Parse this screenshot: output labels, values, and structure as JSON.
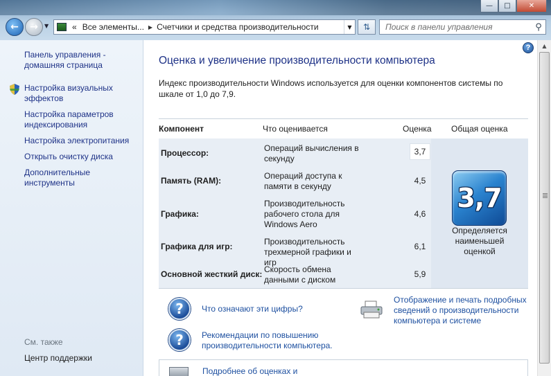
{
  "window": {
    "minimize_glyph": "—",
    "maximize_glyph": "□",
    "close_glyph": "✕"
  },
  "nav": {
    "back_glyph": "←",
    "forward_glyph": "→",
    "dropdown_glyph": "▼"
  },
  "address": {
    "overflow": "«",
    "segment_1": "Все элементы...",
    "separator": "▶",
    "segment_2": "Счетчики и средства производительности",
    "dropdown_glyph": "▼",
    "refresh_glyph": "⇅"
  },
  "search": {
    "placeholder": "Поиск в панели управления",
    "icon": "⚲"
  },
  "sidebar": {
    "items": [
      {
        "label": "Панель управления - домашняя страница"
      },
      {
        "label": "Настройка визуальных эффектов"
      },
      {
        "label": "Настройка параметров индексирования"
      },
      {
        "label": "Настройка электропитания"
      },
      {
        "label": "Открыть очистку диска"
      },
      {
        "label": "Дополнительные инструменты"
      }
    ],
    "see_also": "См. также",
    "support_center": "Центр поддержки"
  },
  "main": {
    "help_glyph": "?",
    "title": "Оценка и увеличение производительности компьютера",
    "intro": "Индекс производительности Windows используется для оценки компонентов системы по шкале от 1,0 до 7,9.",
    "table": {
      "headers": {
        "component": "Компонент",
        "rated": "Что оценивается",
        "score": "Оценка",
        "overall": "Общая оценка"
      },
      "rows": [
        {
          "component": "Процессор:",
          "description": "Операций вычисления в секунду",
          "score": "3,7"
        },
        {
          "component": "Память (RAM):",
          "description": "Операций доступа к памяти в секунду",
          "score": "4,5"
        },
        {
          "component": "Графика:",
          "description": "Производительность рабочего стола для Windows Aero",
          "score": "4,6"
        },
        {
          "component": "Графика для игр:",
          "description": "Производительность трехмерной графики и игр",
          "score": "6,1"
        },
        {
          "component": "Основной жесткий диск:",
          "description": "Скорость обмена данными с диском",
          "score": "5,9"
        }
      ],
      "overall_score": "3,7",
      "overall_note": "Определяется наименьшей оценкой"
    },
    "links": {
      "what_numbers": "Что означают эти цифры?",
      "print_details": "Отображение и печать подробных сведений о производительности компьютера и системе",
      "recommendations": "Рекомендации по повышению производительности компьютера.",
      "more_about": "Подробнее об оценках и"
    },
    "question_glyph": "?"
  },
  "scrollbar": {
    "up_glyph": "▲"
  }
}
